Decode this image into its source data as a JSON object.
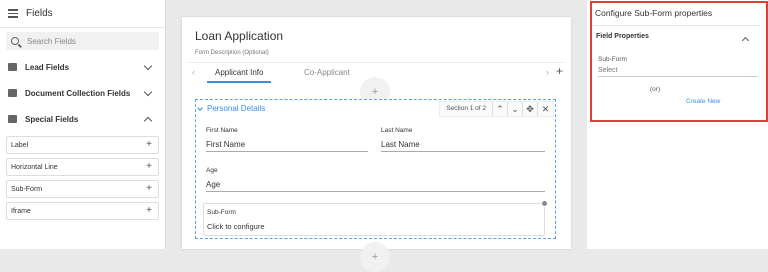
{
  "sidebar": {
    "title": "Fields",
    "search_placeholder": "Search Fields",
    "groups": [
      {
        "label": "Lead Fields",
        "icon": "users-icon",
        "expanded": false
      },
      {
        "label": "Document Collection Fields",
        "icon": "document-icon",
        "expanded": false
      },
      {
        "label": "Special Fields",
        "icon": "special-fields-icon",
        "expanded": true
      }
    ],
    "special_items": [
      "Label",
      "Horizontal Line",
      "Sub-Form",
      "Iframe"
    ],
    "add_glyph": "+"
  },
  "form": {
    "title": "Loan Application",
    "description": "Form Description (Optional)",
    "tabs": [
      {
        "label": "Applicant Info",
        "active": true
      },
      {
        "label": "Co-Applicant",
        "active": false
      }
    ],
    "add_glyph": "+",
    "section": {
      "title": "Personal Details",
      "counter": "Section 1 of 2",
      "fields": [
        {
          "label": "First Name",
          "value": "First Name"
        },
        {
          "label": "Last Name",
          "value": "Last Name"
        },
        {
          "label": "Age",
          "value": "Age"
        }
      ],
      "subform": {
        "label": "Sub-Form",
        "value": "Click to configure"
      }
    }
  },
  "panel": {
    "title": "Configure Sub-Form properties",
    "section_title": "Field Properties",
    "subform_label": "Sub-Form",
    "select_placeholder": "Select",
    "or_text": "(or)",
    "create_new": "Create New"
  },
  "colors": {
    "accent": "#3a8ee6",
    "highlight": "#e03c3c"
  }
}
